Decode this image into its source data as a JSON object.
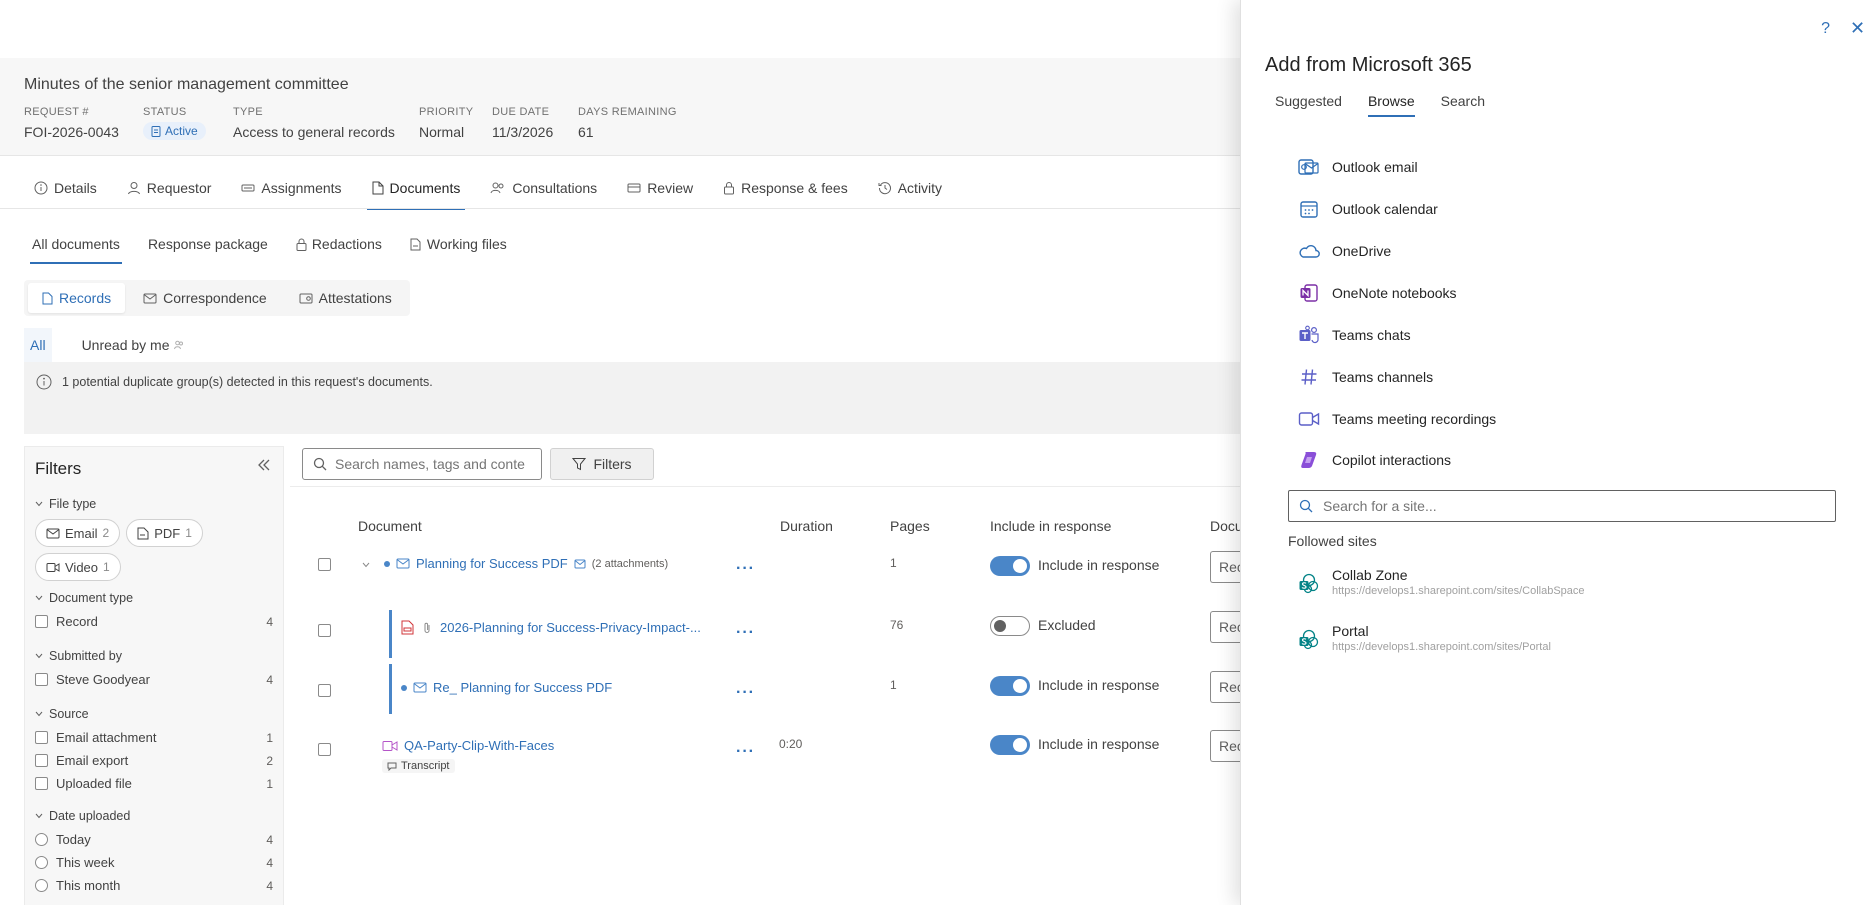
{
  "request": {
    "title": "Minutes of the senior management committee",
    "fields": [
      {
        "label": "REQUEST #",
        "value": "FOI-2026-0043"
      },
      {
        "label": "STATUS",
        "value": "Active"
      },
      {
        "label": "TYPE",
        "value": "Access to general records"
      },
      {
        "label": "PRIORITY",
        "value": "Normal"
      },
      {
        "label": "DUE DATE",
        "value": "11/3/2026"
      },
      {
        "label": "DAYS REMAINING",
        "value": "61"
      }
    ]
  },
  "main_tabs": [
    {
      "label": "Details",
      "icon": "info-icon"
    },
    {
      "label": "Requestor",
      "icon": "person-icon"
    },
    {
      "label": "Assignments",
      "icon": "assign-icon"
    },
    {
      "label": "Documents",
      "icon": "document-icon",
      "active": true
    },
    {
      "label": "Consultations",
      "icon": "people-icon"
    },
    {
      "label": "Review",
      "icon": "review-icon"
    },
    {
      "label": "Response & fees",
      "icon": "lock-icon"
    },
    {
      "label": "Activity",
      "icon": "history-icon"
    }
  ],
  "doc_tabs": [
    "All documents",
    "Response package",
    "Redactions",
    "Working files"
  ],
  "segments": [
    "Records",
    "Correspondence",
    "Attestations"
  ],
  "read_tabs": [
    "All",
    "Unread by me"
  ],
  "notice": "1 potential duplicate group(s) detected in this request's documents.",
  "filters": {
    "title": "Filters",
    "file_type_label": "File type",
    "file_types": [
      {
        "label": "Email",
        "count": "2"
      },
      {
        "label": "PDF",
        "count": "1"
      },
      {
        "label": "Video",
        "count": "1"
      }
    ],
    "document_type_label": "Document type",
    "document_types": [
      {
        "label": "Record",
        "count": "4"
      }
    ],
    "submitted_by_label": "Submitted by",
    "submitted_by": [
      {
        "label": "Steve Goodyear",
        "count": "4"
      }
    ],
    "source_label": "Source",
    "sources": [
      {
        "label": "Email attachment",
        "count": "1"
      },
      {
        "label": "Email export",
        "count": "2"
      },
      {
        "label": "Uploaded file",
        "count": "1"
      }
    ],
    "date_label": "Date uploaded",
    "dates": [
      {
        "label": "Today",
        "count": "4"
      },
      {
        "label": "This week",
        "count": "4"
      },
      {
        "label": "This month",
        "count": "4"
      }
    ]
  },
  "toolbar": {
    "search_placeholder": "Search names, tags and conte...",
    "filters_label": "Filters"
  },
  "table": {
    "headers": [
      "Document",
      "Duration",
      "Pages",
      "Include in response",
      "Docu"
    ],
    "rows": [
      {
        "name": "Planning for Success PDF",
        "extra": "(2 attachments)",
        "duration": "",
        "pages": "1",
        "include": "Include in response",
        "doc": "Rec"
      },
      {
        "name": "2026-Planning for Success-Privacy-Impact-...",
        "extra": "",
        "duration": "",
        "pages": "76",
        "include": "Excluded",
        "doc": "Rec"
      },
      {
        "name": "Re_ Planning for Success PDF",
        "extra": "",
        "duration": "",
        "pages": "1",
        "include": "Include in response",
        "doc": "Rec"
      },
      {
        "name": "QA-Party-Clip-With-Faces",
        "extra": "Transcript",
        "duration": "0:20",
        "pages": "",
        "include": "Include in response",
        "doc": "Rec"
      }
    ]
  },
  "panel": {
    "title": "Add from Microsoft 365",
    "help": "?",
    "close": "✕",
    "tabs": [
      "Suggested",
      "Browse",
      "Search"
    ],
    "sources": [
      {
        "label": "Outlook email",
        "icon": "outlook-email-icon"
      },
      {
        "label": "Outlook calendar",
        "icon": "outlook-calendar-icon"
      },
      {
        "label": "OneDrive",
        "icon": "onedrive-icon"
      },
      {
        "label": "OneNote notebooks",
        "icon": "onenote-icon"
      },
      {
        "label": "Teams chats",
        "icon": "teams-icon"
      },
      {
        "label": "Teams channels",
        "icon": "hash-icon"
      },
      {
        "label": "Teams meeting recordings",
        "icon": "video-icon"
      },
      {
        "label": "Copilot interactions",
        "icon": "copilot-icon"
      }
    ],
    "site_search_placeholder": "Search for a site...",
    "followed_label": "Followed sites",
    "sites": [
      {
        "name": "Collab Zone",
        "url": "https://develops1.sharepoint.com/sites/CollabSpace"
      },
      {
        "name": "Portal",
        "url": "https://develops1.sharepoint.com/sites/Portal"
      }
    ]
  },
  "colors": {
    "accent": "#2f6fb6",
    "toggle_on": "#4a86c8",
    "header_bg": "#f7f7f7"
  }
}
